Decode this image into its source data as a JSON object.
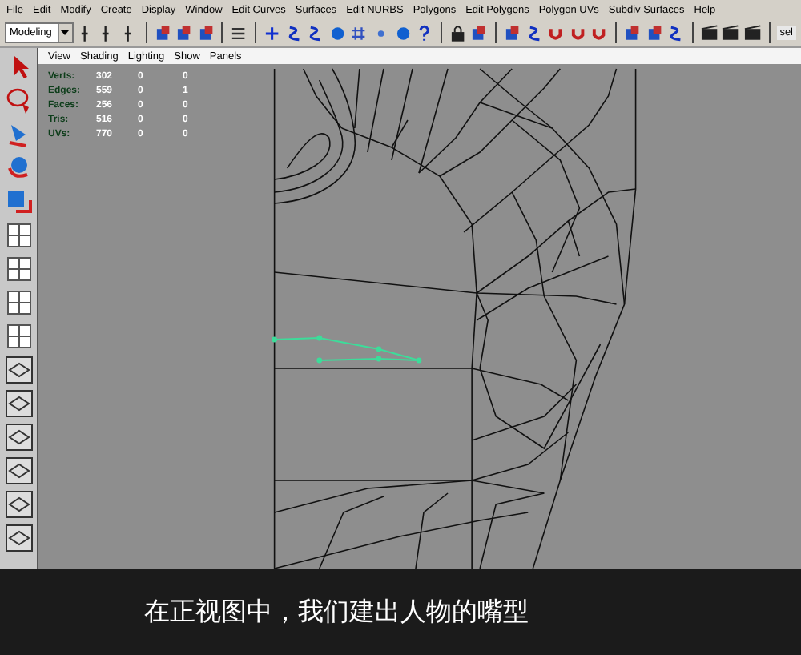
{
  "menu_bar": [
    "File",
    "Edit",
    "Modify",
    "Create",
    "Display",
    "Window",
    "Edit Curves",
    "Surfaces",
    "Edit NURBS",
    "Polygons",
    "Edit Polygons",
    "Polygon UVs",
    "Subdiv Surfaces",
    "Help"
  ],
  "toolbar": {
    "mode": "Modeling",
    "selection_field": "sel"
  },
  "panel_menu": [
    "View",
    "Shading",
    "Lighting",
    "Show",
    "Panels"
  ],
  "poly_stats": [
    {
      "label": "Verts:",
      "values": [
        "302",
        "0",
        "0"
      ]
    },
    {
      "label": "Edges:",
      "values": [
        "559",
        "0",
        "1"
      ]
    },
    {
      "label": "Faces:",
      "values": [
        "256",
        "0",
        "0"
      ]
    },
    {
      "label": "Tris:",
      "values": [
        "516",
        "0",
        "0"
      ]
    },
    {
      "label": "UVs:",
      "values": [
        "770",
        "0",
        "0"
      ]
    }
  ],
  "subtitle": "在正视图中，我们建出人物的嘴型"
}
